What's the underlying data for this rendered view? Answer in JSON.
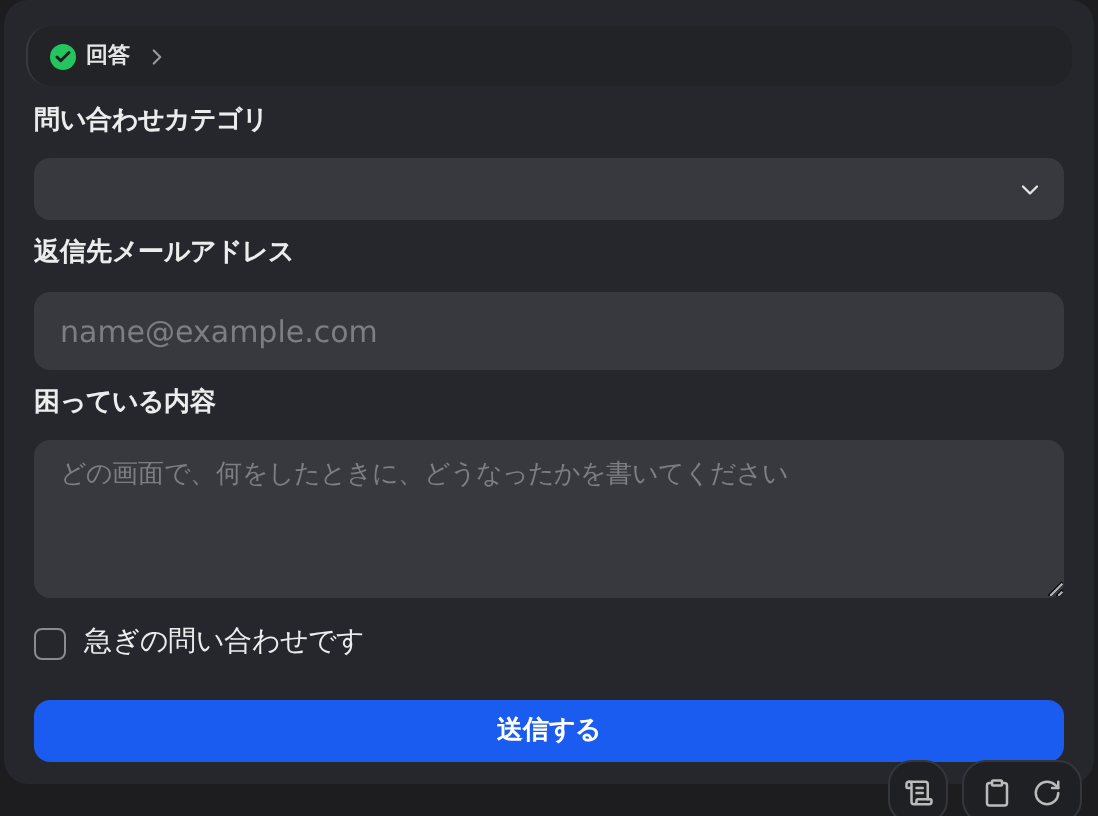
{
  "header": {
    "title": "回答",
    "done": true
  },
  "fields": [
    {
      "kind": "select",
      "label": "問い合わせカテゴリ"
    },
    {
      "kind": "input",
      "label": "返信先メールアドレス",
      "placeholder": "name@example.com"
    },
    {
      "kind": "textarea",
      "label": "困っている内容",
      "placeholder": "どの画面で、何をしたときに、どうなったかを書いてください"
    }
  ],
  "urgent": {
    "label": "急ぎの問い合わせです",
    "checked": false
  },
  "submit": "送信する"
}
